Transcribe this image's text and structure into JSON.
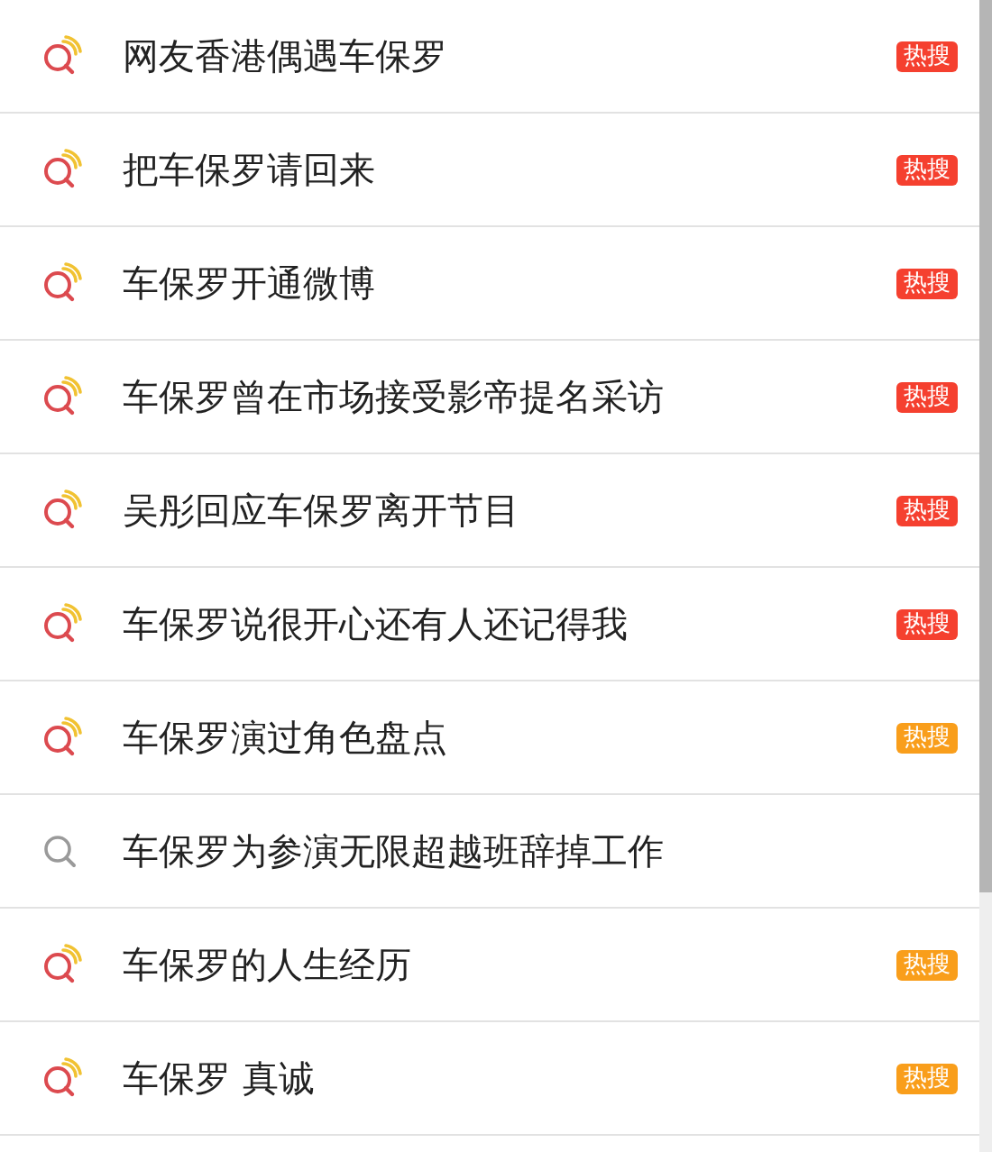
{
  "results": [
    {
      "kind": "hot",
      "text": "网友香港偶遇车保罗",
      "badge": {
        "text": "热搜",
        "color": "#f5402f"
      }
    },
    {
      "kind": "hot",
      "text": "把车保罗请回来",
      "badge": {
        "text": "热搜",
        "color": "#f5402f"
      }
    },
    {
      "kind": "hot",
      "text": "车保罗开通微博",
      "badge": {
        "text": "热搜",
        "color": "#f5402f"
      }
    },
    {
      "kind": "hot",
      "text": "车保罗曾在市场接受影帝提名采访",
      "badge": {
        "text": "热搜",
        "color": "#f5402f"
      }
    },
    {
      "kind": "hot",
      "text": "吴彤回应车保罗离开节目",
      "badge": {
        "text": "热搜",
        "color": "#f5402f"
      }
    },
    {
      "kind": "hot",
      "text": "车保罗说很开心还有人还记得我",
      "badge": {
        "text": "热搜",
        "color": "#f5402f"
      }
    },
    {
      "kind": "hot",
      "text": "车保罗演过角色盘点",
      "badge": {
        "text": "热搜",
        "color": "#f99e1b"
      }
    },
    {
      "kind": "plain",
      "text": "车保罗为参演无限超越班辞掉工作"
    },
    {
      "kind": "hot",
      "text": "车保罗的人生经历",
      "badge": {
        "text": "热搜",
        "color": "#f99e1b"
      }
    },
    {
      "kind": "hot",
      "text": "车保罗 真诚",
      "badge": {
        "text": "热搜",
        "color": "#f99e1b"
      }
    }
  ]
}
